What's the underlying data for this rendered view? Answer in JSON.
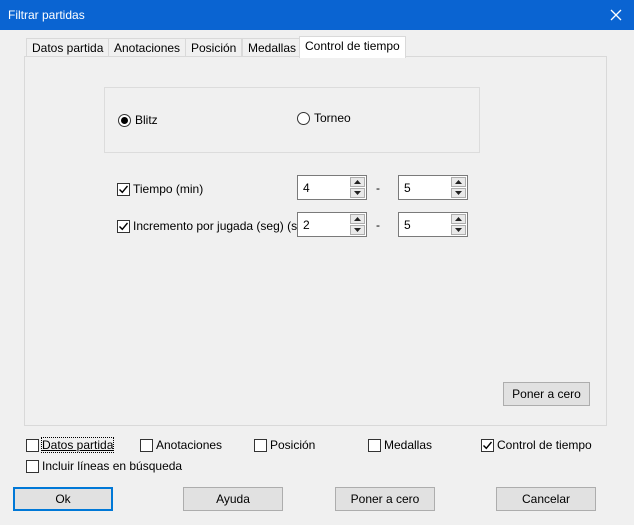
{
  "window": {
    "title": "Filtrar partidas"
  },
  "tabs": [
    {
      "label": "Datos partida"
    },
    {
      "label": "Anotaciones"
    },
    {
      "label": "Posición"
    },
    {
      "label": "Medallas"
    },
    {
      "label": "Control de tiempo",
      "active": true
    }
  ],
  "time_control": {
    "radios": [
      {
        "label": "Blitz",
        "checked": true
      },
      {
        "label": "Torneo",
        "checked": false
      }
    ],
    "rows": [
      {
        "label": "Tiempo (min)",
        "checked": true,
        "from": "4",
        "to": "5"
      },
      {
        "label": "Incremento por jugada (seg) (s",
        "checked": true,
        "from": "2",
        "to": "5"
      }
    ],
    "separator": "-",
    "reset_label": "Poner a cero"
  },
  "filters": {
    "items": [
      {
        "label": "Datos partida",
        "checked": false
      },
      {
        "label": "Anotaciones",
        "checked": false
      },
      {
        "label": "Posición",
        "checked": false
      },
      {
        "label": "Medallas",
        "checked": false
      },
      {
        "label": "Control de tiempo",
        "checked": true
      }
    ],
    "include_lines": {
      "label": "Incluir líneas en búsqueda",
      "checked": false
    }
  },
  "buttons": {
    "ok": "Ok",
    "help": "Ayuda",
    "reset": "Poner a cero",
    "cancel": "Cancelar"
  },
  "colors": {
    "titlebar": "#0a64d2",
    "default_button_border": "#0078d7"
  }
}
